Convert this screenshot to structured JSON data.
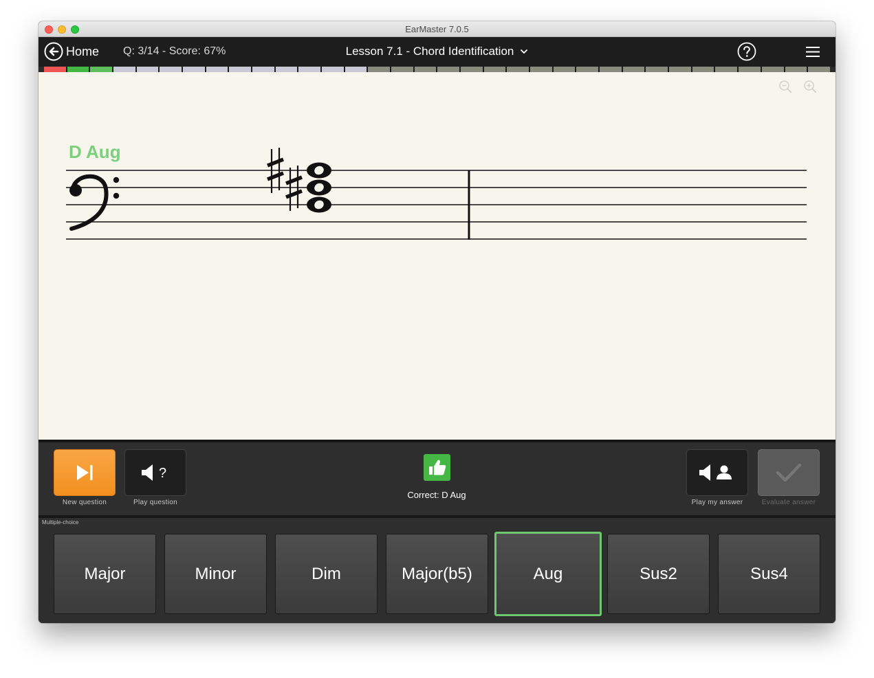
{
  "window": {
    "title": "EarMaster 7.0.5"
  },
  "topbar": {
    "home_label": "Home",
    "score_text": "Q: 3/14 - Score: 67%",
    "lesson_title": "Lesson 7.1 - Chord Identification"
  },
  "progress": {
    "segments": [
      "wrong",
      "correct",
      "current",
      "pending",
      "pending",
      "pending",
      "pending",
      "pending",
      "pending",
      "pending",
      "pending",
      "pending",
      "pending",
      "pending",
      "future",
      "future",
      "future",
      "future",
      "future",
      "future",
      "future",
      "future",
      "future",
      "future",
      "future",
      "future",
      "future",
      "future",
      "future",
      "future",
      "future",
      "future",
      "future",
      "future"
    ],
    "colors": {
      "wrong": "#f05454",
      "correct": "#45b745",
      "current": "#5fbf5f",
      "pending": "#c9c9d6",
      "future": "#8a8c7e"
    }
  },
  "score": {
    "chord_label": "D Aug",
    "clef": "bass",
    "chord_notes": [
      "D",
      "F#",
      "A#"
    ]
  },
  "controls": {
    "new_question": "New question",
    "play_question": "Play question",
    "feedback": "Correct: D Aug",
    "play_my_answer": "Play my answer",
    "evaluate_answer": "Evaluate answer"
  },
  "choices": {
    "section_label": "Multiple-choice",
    "items": [
      "Major",
      "Minor",
      "Dim",
      "Major(b5)",
      "Aug",
      "Sus2",
      "Sus4"
    ],
    "selected_index": 4
  },
  "colors": {
    "accent_orange": "#f39322",
    "correct_green": "#45b745",
    "chord_label_green": "#7bcf7d"
  }
}
